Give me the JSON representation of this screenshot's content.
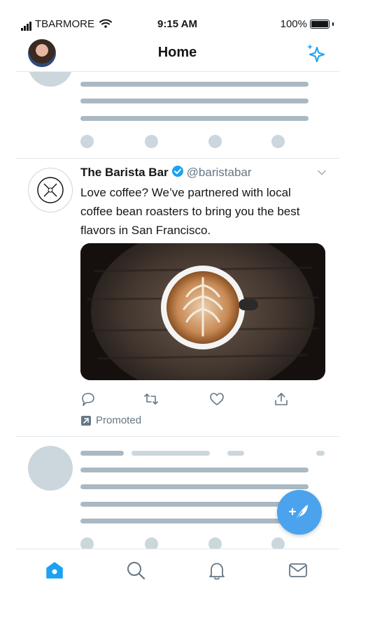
{
  "status_bar": {
    "carrier": "TBARMORE",
    "time": "9:15 AM",
    "battery": "100%"
  },
  "header": {
    "title": "Home",
    "avatar_icon": "profile-avatar",
    "right_icon": "sparkle-icon"
  },
  "tweet": {
    "name": "The Barista Bar",
    "handle": "@baristabar",
    "text": "Love coffee? We’ve partnered with local coffee bean roasters to bring you the best flavors in San Francisco.",
    "promoted_label": "Promoted",
    "media_description": "latte art coffee cup on wooden table",
    "actions": [
      "reply-icon",
      "retweet-icon",
      "like-icon",
      "share-icon"
    ]
  },
  "colors": {
    "accent": "#1da1f2",
    "fab": "#4aa3ec",
    "skeleton": "#ccd6dd",
    "skeleton_dark": "#aab8c2",
    "secondary_text": "#657786"
  },
  "tabbar": {
    "items": [
      "home-icon",
      "search-icon",
      "notifications-icon",
      "messages-icon"
    ],
    "active": "home-icon"
  }
}
